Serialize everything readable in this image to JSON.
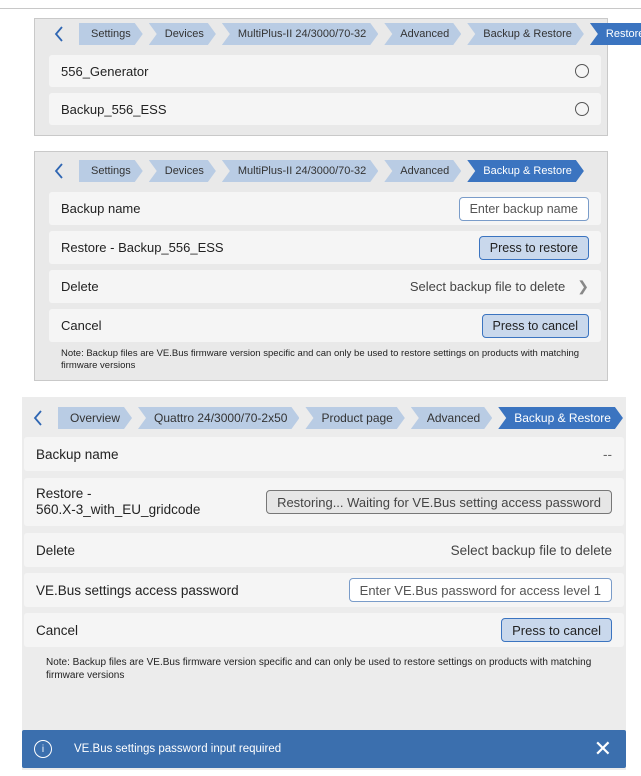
{
  "screen1": {
    "breadcrumbs": [
      "Settings",
      "Devices",
      "MultiPlus-II 24/3000/70-32",
      "Advanced",
      "Backup & Restore",
      "Restore"
    ],
    "items": [
      "556_Generator",
      "Backup_556_ESS"
    ]
  },
  "screen2": {
    "breadcrumbs": [
      "Settings",
      "Devices",
      "MultiPlus-II 24/3000/70-32",
      "Advanced",
      "Backup & Restore"
    ],
    "backup_name_label": "Backup name",
    "backup_name_placeholder": "Enter backup name",
    "restore_label": "Restore - Backup_556_ESS",
    "restore_button": "Press to restore",
    "delete_label": "Delete",
    "delete_value": "Select backup file to delete",
    "cancel_label": "Cancel",
    "cancel_button": "Press to cancel",
    "note": "Note: Backup files are VE.Bus firmware version specific and can only be used to restore settings on products with matching firmware versions"
  },
  "screen3": {
    "breadcrumbs": [
      "Overview",
      "Quattro 24/3000/70-2x50",
      "Product page",
      "Advanced",
      "Backup & Restore"
    ],
    "backup_name_label": "Backup name",
    "backup_name_value": "--",
    "restore_label_line1": "Restore -",
    "restore_label_line2": "560.X-3_with_EU_gridcode",
    "restore_status": "Restoring... Waiting for VE.Bus setting access password",
    "delete_label": "Delete",
    "delete_value": "Select backup file to delete",
    "password_label": "VE.Bus settings access password",
    "password_placeholder": "Enter VE.Bus password for access level 1",
    "cancel_label": "Cancel",
    "cancel_button": "Press to cancel",
    "note": "Note: Backup files are VE.Bus firmware version specific and can only be used to restore settings on products with matching firmware versions"
  },
  "toast": {
    "message": "VE.Bus settings password input required",
    "info_icon": "info-icon",
    "close_icon": "close-icon"
  },
  "colors": {
    "accent": "#3b74c0",
    "crumb": "#b9cce4",
    "toast": "#3b6fae"
  }
}
